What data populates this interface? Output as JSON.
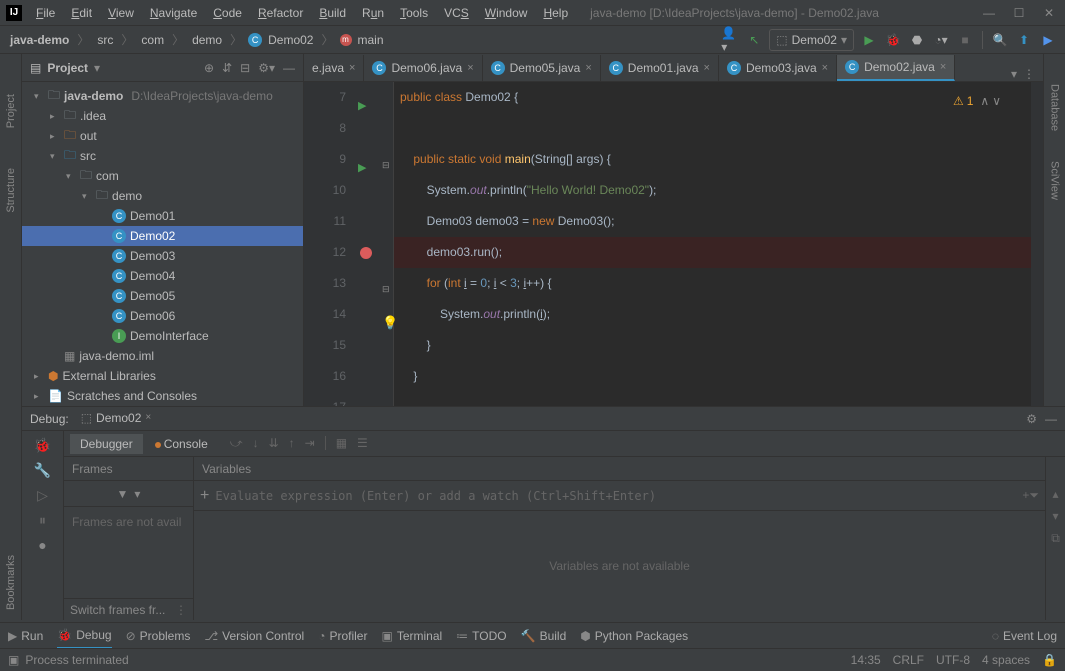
{
  "title": "java-demo [D:\\IdeaProjects\\java-demo] - Demo02.java",
  "menu": [
    "File",
    "Edit",
    "View",
    "Navigate",
    "Code",
    "Refactor",
    "Build",
    "Run",
    "Tools",
    "VCS",
    "Window",
    "Help"
  ],
  "breadcrumb": [
    "java-demo",
    "src",
    "com",
    "demo",
    "Demo02",
    "main"
  ],
  "runConfig": "Demo02",
  "leftTabs": [
    "Project",
    "Structure"
  ],
  "leftTabs2": [
    "Bookmarks"
  ],
  "rightTabs": [
    "Database",
    "SciView"
  ],
  "projectHeader": "Project",
  "tree": {
    "root": {
      "name": "java-demo",
      "path": "D:\\IdeaProjects\\java-demo"
    },
    "idea": ".idea",
    "out": "out",
    "src": "src",
    "com": "com",
    "demo": "demo",
    "classes": [
      "Demo01",
      "Demo02",
      "Demo03",
      "Demo04",
      "Demo05",
      "Demo06"
    ],
    "iface": "DemoInterface",
    "iml": "java-demo.iml",
    "ext": "External Libraries",
    "scratch": "Scratches and Consoles"
  },
  "tabs": [
    "e.java",
    "Demo06.java",
    "Demo05.java",
    "Demo01.java",
    "Demo03.java",
    "Demo02.java"
  ],
  "activeTab": 5,
  "warnCount": "1",
  "code": {
    "l7": "public class Demo02 {",
    "l9a": "public static void ",
    "l9b": "main",
    "l9c": "(String[] args) {",
    "l10a": "System.",
    "l10b": "out",
    "l10c": ".println(",
    "l10d": "\"Hello World! Demo02\"",
    "l10e": ");",
    "l11a": "Demo03 demo03 = ",
    "l11b": "new ",
    "l11c": "Demo03();",
    "l12": "demo03.run();",
    "l13a": "for ",
    "l13b": "(",
    "l13c": "int ",
    "l13d": "i = ",
    "l13e": "0",
    "l13f": "; i < ",
    "l13g": "3",
    "l13h": "; i++) {",
    "l14a": "System.",
    "l14b": "out",
    "l14c": ".println(i);",
    "l15": "}",
    "l16": "}"
  },
  "lineNumbers": [
    "7",
    "8",
    "9",
    "10",
    "11",
    "12",
    "13",
    "14",
    "15",
    "16",
    "17"
  ],
  "debug": {
    "label": "Debug:",
    "config": "Demo02",
    "tabDebugger": "Debugger",
    "tabConsole": "Console",
    "frames": "Frames",
    "variables": "Variables",
    "evalPlaceholder": "Evaluate expression (Enter) or add a watch (Ctrl+Shift+Enter)",
    "framesNA": "Frames are not avail",
    "varsNA": "Variables are not available",
    "switchFrames": "Switch frames fr..."
  },
  "bottomTabs": {
    "run": "Run",
    "debug": "Debug",
    "problems": "Problems",
    "versionControl": "Version Control",
    "profiler": "Profiler",
    "terminal": "Terminal",
    "todo": "TODO",
    "build": "Build",
    "pythonPackages": "Python Packages",
    "eventLog": "Event Log"
  },
  "status": {
    "msg": "Process terminated",
    "time": "14:35",
    "eol": "CRLF",
    "enc": "UTF-8",
    "indent": "4 spaces"
  }
}
